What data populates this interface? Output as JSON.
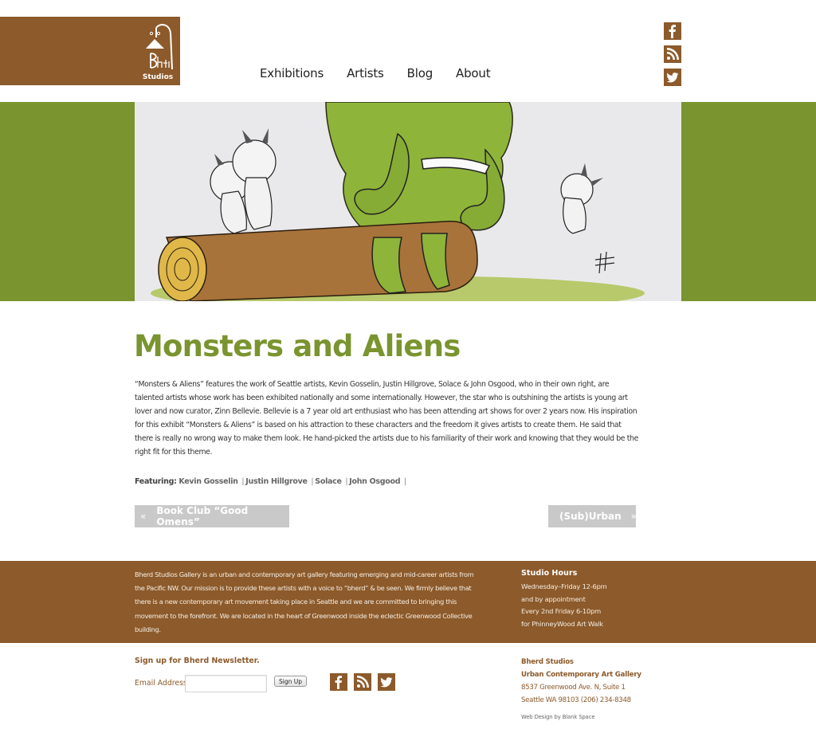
{
  "header": {
    "logo_alt": "Bherd Studios",
    "brand_color": "#8c5a2b",
    "accent_color": "#7a942f",
    "nav": [
      {
        "label": "Exhibitions"
      },
      {
        "label": "Artists"
      },
      {
        "label": "Blog"
      },
      {
        "label": "About"
      }
    ],
    "social": [
      {
        "icon": "facebook-icon"
      },
      {
        "icon": "rss-icon"
      },
      {
        "icon": "twitter-icon"
      }
    ]
  },
  "hero": {
    "image_description": "Watercolor illustration of a green furry monster sitting on a log with small white horned creatures"
  },
  "article": {
    "title": "Monsters and Aliens",
    "body": "“Monsters & Aliens” features the work of Seattle artists, Kevin Gosselin, Justin Hillgrove, Solace & John Osgood, who in their own right, are talented artists whose work has been exhibited nationally and some internationally. However, the star who is outshining the artists is young art lover and now curator, Zinn Bellevie. Bellevie is a 7 year old art enthusiast who has been attending art shows for over 2 years now. His inspiration for this exhibit “Monsters & Aliens” is based on his attraction to these characters and the freedom it gives artists to create them. He said that there is really no wrong way to make them look. He hand-picked the artists due to his familiarity of their work and knowing that they would be the right fit for this theme.",
    "featuring_label": "Featuring:",
    "featuring": [
      "Kevin Gosselin",
      "Justin Hillgrove",
      "Solace",
      "John Osgood"
    ],
    "separator": "|",
    "prev": {
      "arrow": "«",
      "label": "Book Club “Good Omens”"
    },
    "next": {
      "arrow": "»",
      "label": "(Sub)Urban"
    }
  },
  "footer": {
    "about": "Bherd Studios Gallery is an urban and contemporary art gallery featuring emerging and mid-career artists from the Pacific NW. Our mission is to provide these artists with a voice to “bherd” & be seen. We firmly believe that there is a new contemporary art movement taking place in Seattle and we are committed to bringing this movement to the forefront. We are located in the heart of Greenwood inside the eclectic Greenwood Collective building.",
    "hours_title": "Studio Hours",
    "hours": [
      "Wednesday–Friday 12-6pm",
      "and by appointment",
      "Every 2nd Friday 6-10pm",
      "for PhinneyWood Art Walk"
    ],
    "newsletter_title": "Sign up for Bherd Newsletter.",
    "email_label": "Email Address",
    "email_value": "",
    "signup_label": "Sign Up",
    "address": {
      "name": "Bherd Studios",
      "tagline": "Urban Contemporary Art Gallery",
      "street": "8537 Greenwood Ave. N, Suite 1",
      "city_phone": "Seattle WA 98103 (206) 234-8348"
    },
    "credit": "Web Design by Blank Space"
  }
}
